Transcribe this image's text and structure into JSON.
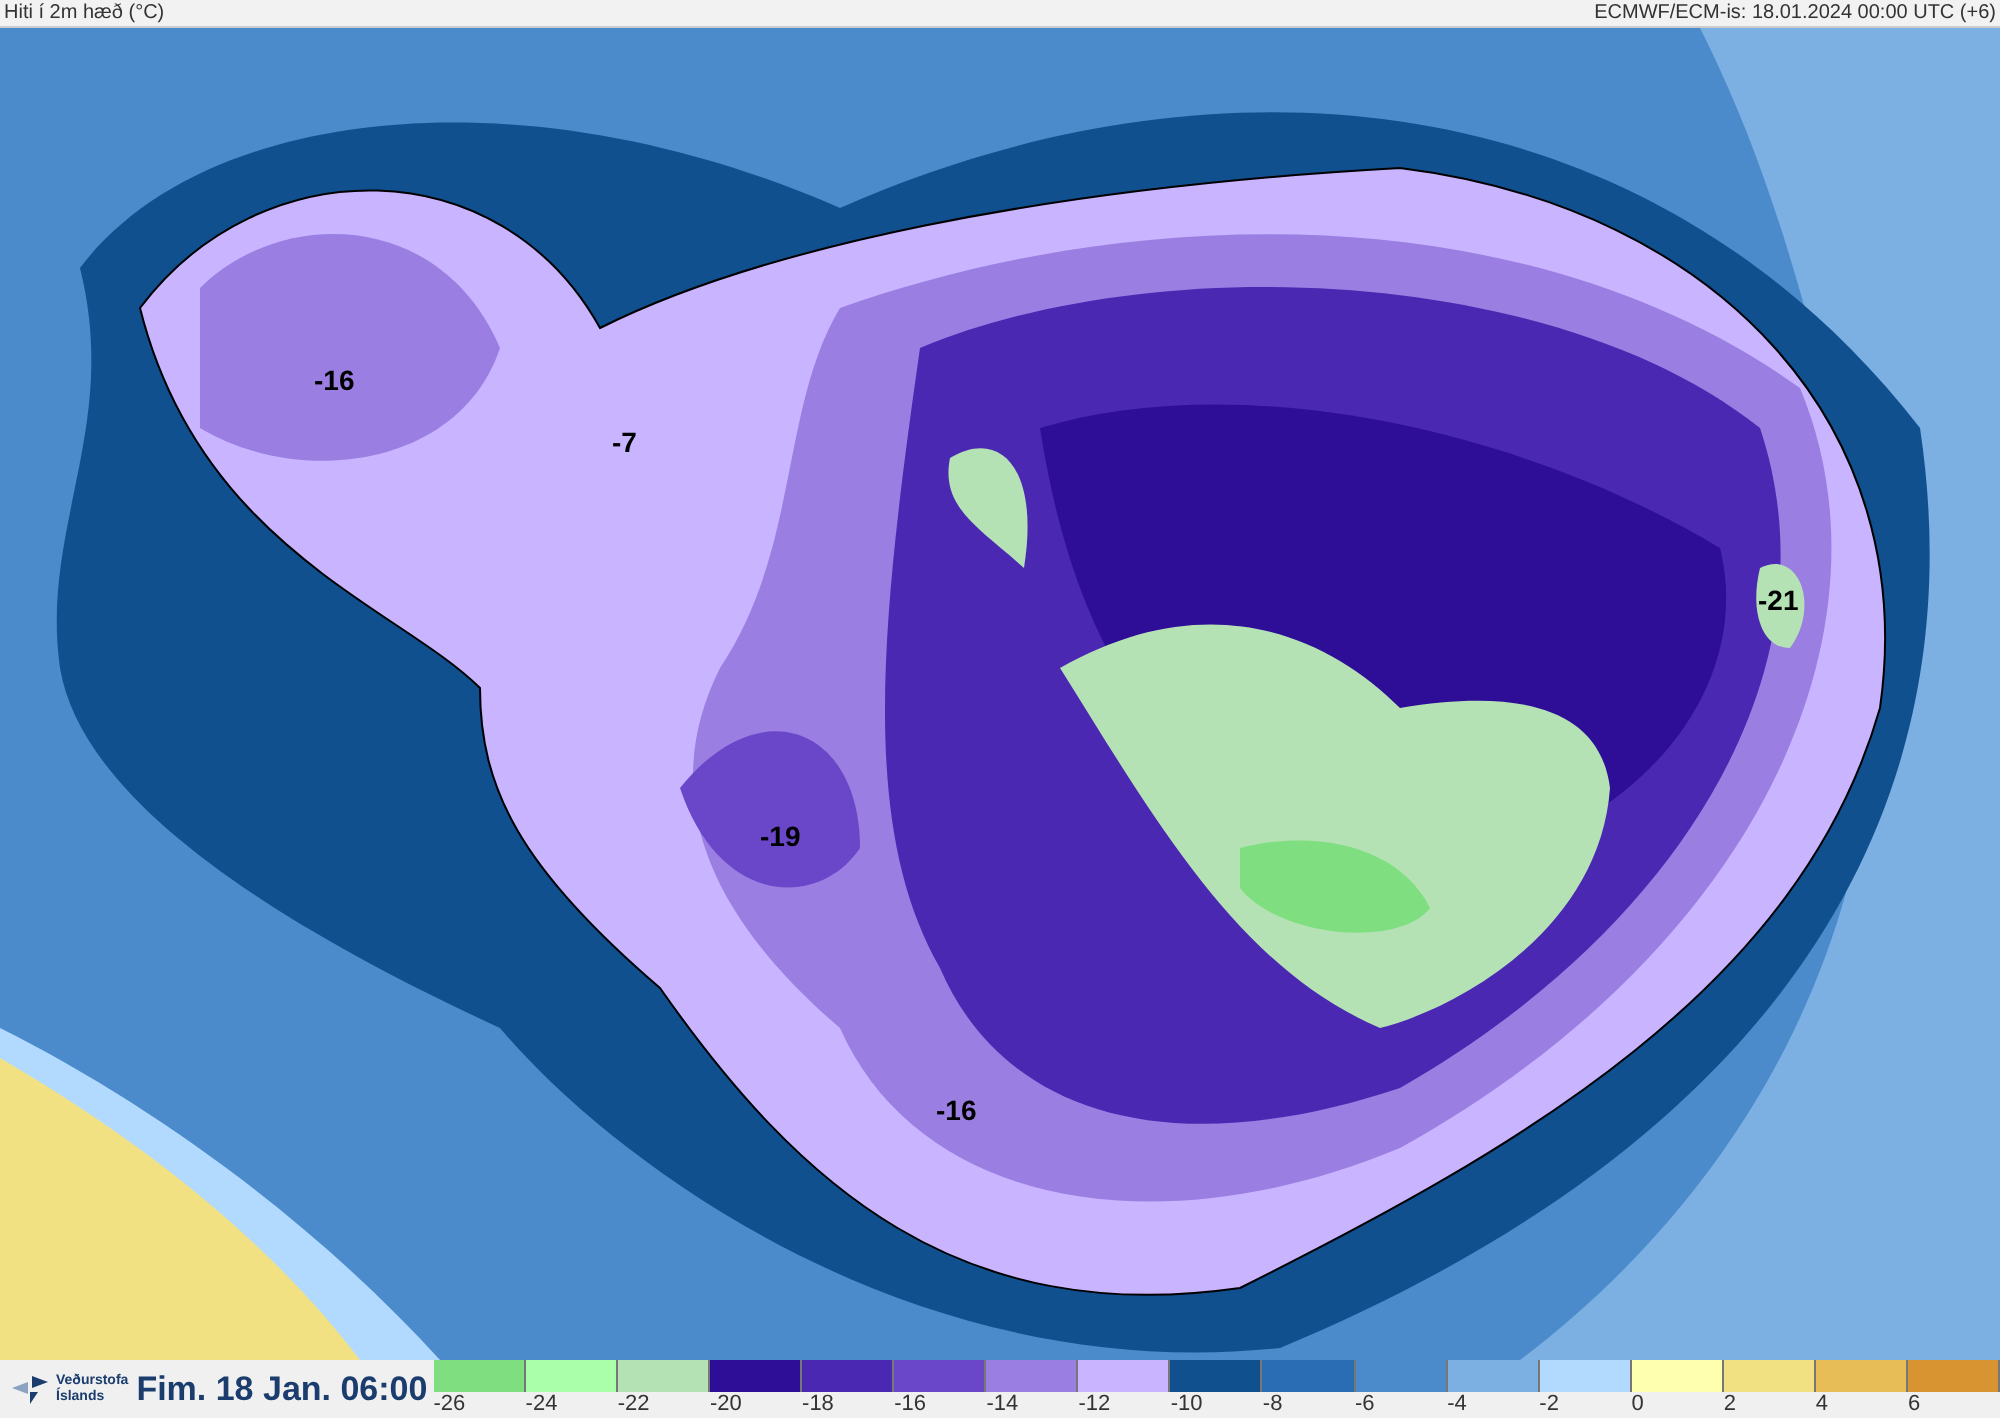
{
  "header": {
    "title": "Hiti í 2m hæð (°C)",
    "run_info": "ECMWF/ECM-is: 18.01.2024 00:00 UTC (+6)"
  },
  "map": {
    "labels": [
      "-16",
      "-7",
      "-21",
      "-19",
      "-16"
    ]
  },
  "footer": {
    "logo_lines": [
      "Veðurstofa",
      "Íslands"
    ],
    "valid_time": "Fim. 18 Jan. 06:00"
  },
  "legend": [
    {
      "label": "-26",
      "color": "#7fde7f"
    },
    {
      "label": "-24",
      "color": "#aaffaa"
    },
    {
      "label": "-22",
      "color": "#b4e2b4"
    },
    {
      "label": "-20",
      "color": "#2e0e96"
    },
    {
      "label": "-18",
      "color": "#4b28b2"
    },
    {
      "label": "-16",
      "color": "#6a46c8"
    },
    {
      "label": "-14",
      "color": "#9a7ee2"
    },
    {
      "label": "-12",
      "color": "#c8b4ff"
    },
    {
      "label": "-10",
      "color": "#10508f"
    },
    {
      "label": "-8",
      "color": "#2a6db5"
    },
    {
      "label": "-6",
      "color": "#4b8bcc"
    },
    {
      "label": "-4",
      "color": "#7cb0e2"
    },
    {
      "label": "-2",
      "color": "#b2daff"
    },
    {
      "label": "0",
      "color": "#ffffb0"
    },
    {
      "label": "2",
      "color": "#f2e182"
    },
    {
      "label": "4",
      "color": "#e6bd56"
    },
    {
      "label": "6",
      "color": "#d99432"
    }
  ]
}
